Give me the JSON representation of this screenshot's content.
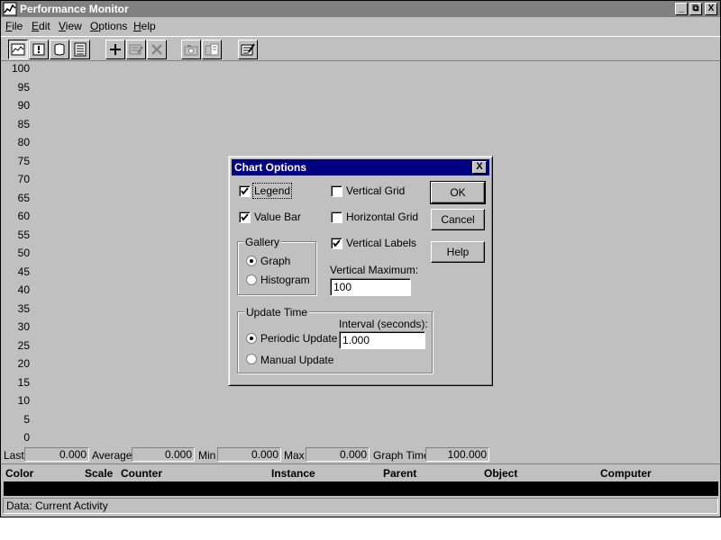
{
  "window": {
    "title": "Performance Monitor",
    "caption_buttons": [
      "_",
      "⧉",
      "X"
    ]
  },
  "menu": {
    "items": [
      {
        "label": "File",
        "mnemonic": "F",
        "rest": "ile"
      },
      {
        "label": "Edit",
        "mnemonic": "E",
        "rest": "dit"
      },
      {
        "label": "View",
        "mnemonic": "V",
        "rest": "iew"
      },
      {
        "label": "Options",
        "mnemonic": "O",
        "rest": "ptions"
      },
      {
        "label": "Help",
        "mnemonic": "H",
        "rest": "elp"
      }
    ]
  },
  "toolbar": {
    "buttons": [
      "chart-view",
      "alert-view",
      "log-view",
      "report-view",
      "add-counter",
      "edit-counter",
      "delete-counter",
      "update-now",
      "bookmark",
      "options"
    ]
  },
  "chart": {
    "y_ticks": [
      "100",
      "95",
      "90",
      "85",
      "80",
      "75",
      "70",
      "65",
      "60",
      "55",
      "50",
      "45",
      "40",
      "35",
      "30",
      "25",
      "20",
      "15",
      "10",
      "5",
      "0"
    ]
  },
  "stats": {
    "last_label": "Last",
    "last_value": "0.000",
    "average_label": "Average",
    "average_value": "0.000",
    "min_label": "Min",
    "min_value": "0.000",
    "max_label": "Max",
    "max_value": "0.000",
    "graph_time_label": "Graph Time",
    "graph_time_value": "100.000"
  },
  "legend": {
    "columns": [
      "Color",
      "Scale",
      "Counter",
      "Instance",
      "Parent",
      "Object",
      "Computer"
    ]
  },
  "status_bar": {
    "text": "Data: Current Activity"
  },
  "dialog": {
    "title": "Chart Options",
    "close_label": "X",
    "legend_label": "Legend",
    "legend_checked": true,
    "value_bar_label": "Value Bar",
    "value_bar_checked": true,
    "gallery_title": "Gallery",
    "graph_label": "Graph",
    "graph_selected": true,
    "histogram_label": "Histogram",
    "histogram_selected": false,
    "vertical_grid_label": "Vertical Grid",
    "vertical_grid_checked": false,
    "horizontal_grid_label": "Horizontal Grid",
    "horizontal_grid_checked": false,
    "vertical_labels_label": "Vertical Labels",
    "vertical_labels_checked": true,
    "vertical_maximum_label": "Vertical Maximum:",
    "vertical_maximum_value": "100",
    "update_time_title": "Update Time",
    "interval_label": "Interval (seconds):",
    "interval_value": "1.000",
    "periodic_update_label": "Periodic Update",
    "periodic_selected": true,
    "manual_update_label": "Manual Update",
    "manual_selected": false,
    "ok_label": "OK",
    "cancel_label": "Cancel",
    "help_label": "Help"
  }
}
